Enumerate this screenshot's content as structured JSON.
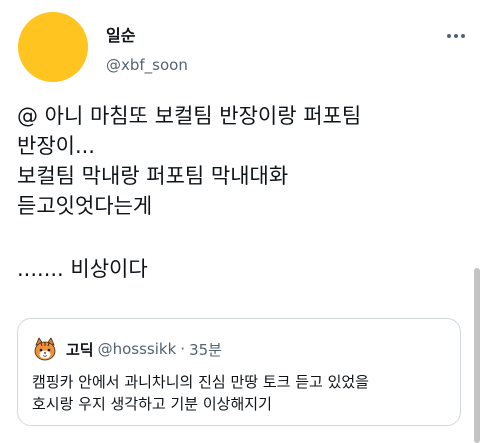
{
  "tweet": {
    "author": {
      "display_name": "일순",
      "handle": "@xbf_soon",
      "avatar_color": "#FFC41F"
    },
    "more_icon": "more-horizontal-icon",
    "lines": [
      "@ 아니 마침또 보컬팀 반장이랑 퍼포팀",
      "반장이...",
      "보컬팀 막내랑 퍼포팀 막내대화",
      "듣고잇엇다는게",
      "",
      "....... 비상이다"
    ]
  },
  "quote": {
    "author": {
      "display_name": "고딕",
      "handle": "@hosssikk",
      "separator": "·",
      "time": "35분",
      "avatar_icon": "tiger-cat-avatar"
    },
    "lines": [
      "캠핑카 안에서 과니차니의 진심 만땅 토크 듣고 있었을",
      "호시랑 우지 생각하고 기분 이상해지기"
    ]
  }
}
